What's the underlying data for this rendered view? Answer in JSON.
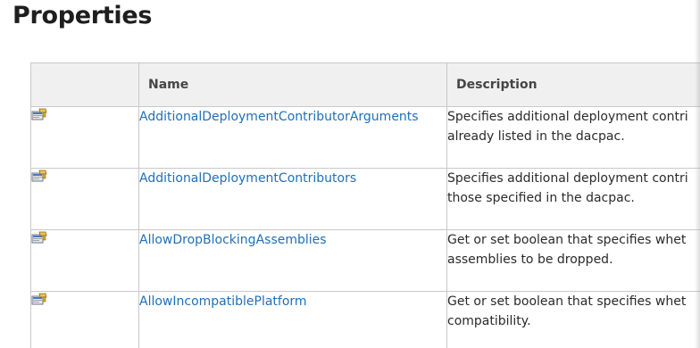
{
  "page": {
    "title": "Properties"
  },
  "table": {
    "headers": {
      "icon": "",
      "name": "Name",
      "description": "Description"
    },
    "rows": [
      {
        "icon": "property-icon",
        "name": "AdditionalDeploymentContributorArguments",
        "description_line1": "Specifies additional deployment contri",
        "description_line2": "already listed in the dacpac."
      },
      {
        "icon": "property-icon",
        "name": "AdditionalDeploymentContributors",
        "description_line1": "Specifies additional deployment contri",
        "description_line2": "those specified in the dacpac."
      },
      {
        "icon": "property-icon",
        "name": "AllowDropBlockingAssemblies",
        "description_line1": "Get or set boolean that specifies whet",
        "description_line2": "assemblies to be dropped."
      },
      {
        "icon": "property-icon",
        "name": "AllowIncompatiblePlatform",
        "description_line1": "Get or set boolean that specifies whet",
        "description_line2": "compatibility."
      }
    ]
  },
  "colors": {
    "link": "#1f6fb8",
    "header_bg": "#f0f0f0",
    "border": "#c8c8c8"
  }
}
